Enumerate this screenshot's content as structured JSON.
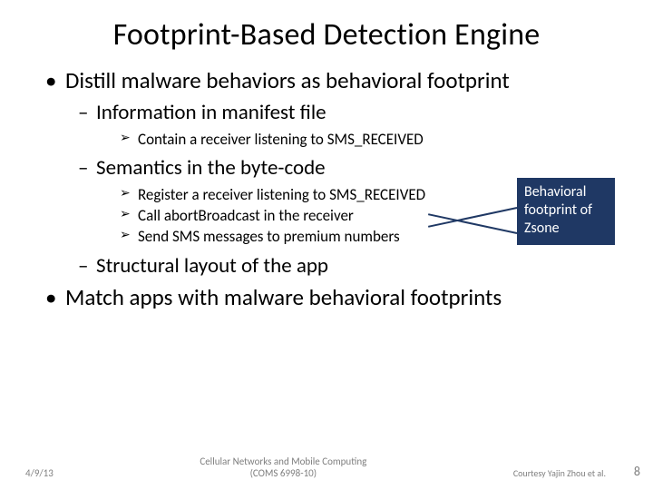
{
  "title": "Footprint-Based Detection Engine",
  "bullets": {
    "b1a": "Distill malware behaviors as behavioral footprint",
    "b2a": "Information in manifest file",
    "b3a": "Contain a receiver listening to SMS_RECEIVED",
    "b2b": "Semantics in the byte-code",
    "b3b": "Register a receiver listening to SMS_RECEIVED",
    "b3c": "Call abortBroadcast in the receiver",
    "b3d": "Send SMS messages to premium numbers",
    "b2c": "Structural layout of the app",
    "b1b": "Match apps with malware behavioral footprints"
  },
  "callout": "Behavioral footprint of Zsone",
  "footer": {
    "date": "4/9/13",
    "center_line1": "Cellular Networks and Mobile Computing",
    "center_line2": "(COMS 6998-10)",
    "courtesy": "Courtesy Yajin Zhou et al.",
    "page": "8"
  }
}
